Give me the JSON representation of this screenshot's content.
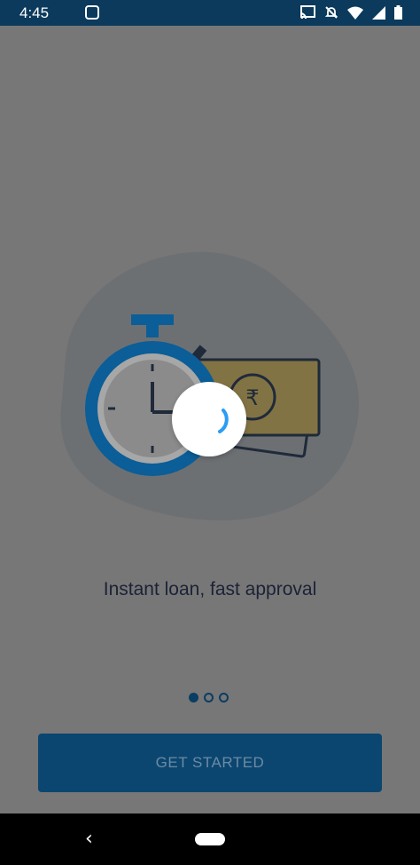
{
  "status_bar": {
    "time": "4:45",
    "icons": [
      "gallery-icon",
      "cast-icon",
      "mute-icon",
      "wifi-icon",
      "signal-icon",
      "battery-icon"
    ]
  },
  "onboarding": {
    "headline": "Instant loan, fast approval",
    "pager": {
      "count": 3,
      "active_index": 0
    },
    "cta_label": "GET STARTED"
  },
  "illustration": {
    "currency_symbol": "₹",
    "icons": [
      "stopwatch-icon",
      "banknote-icon"
    ]
  },
  "loading": {
    "visible": true
  },
  "colors": {
    "status_bar": "#0b3a5c",
    "overlay_background": "#777777",
    "cta_background": "#0a4670",
    "cta_text": "#6e8aa3",
    "headline": "#1c2236",
    "spinner": "#2a9df4",
    "stopwatch_blue": "#0b5e98",
    "banknote_gold": "#8a7a3a"
  }
}
